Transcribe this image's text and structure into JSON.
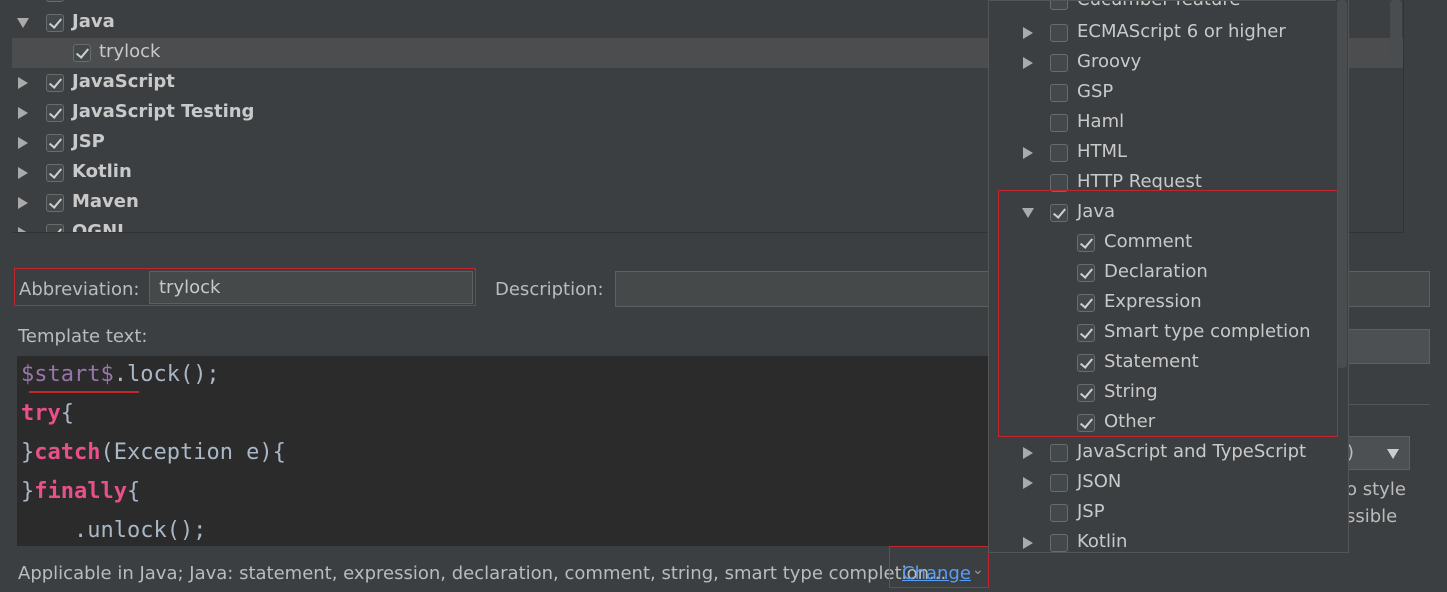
{
  "tree": {
    "rows": [
      {
        "label": "",
        "checked": true,
        "expandable": true,
        "expanded": false
      },
      {
        "label": "Java",
        "checked": true,
        "expandable": true,
        "expanded": true
      },
      {
        "label": "trylock",
        "checked": true,
        "expandable": false,
        "selected": true
      },
      {
        "label": "JavaScript",
        "checked": true,
        "expandable": true
      },
      {
        "label": "JavaScript Testing",
        "checked": true,
        "expandable": true
      },
      {
        "label": "JSP",
        "checked": true,
        "expandable": true
      },
      {
        "label": "Kotlin",
        "checked": true,
        "expandable": true
      },
      {
        "label": "Maven",
        "checked": true,
        "expandable": true
      },
      {
        "label": "OGNL",
        "checked": true,
        "expandable": true
      }
    ]
  },
  "form": {
    "abbreviation_label": "Abbreviation:",
    "abbreviation_value": "trylock",
    "description_label": "Description:",
    "description_value": "",
    "template_text_label": "Template text:"
  },
  "editor": {
    "lines": [
      {
        "parts": [
          {
            "t": "$start$",
            "c": "var"
          },
          {
            "t": ".lock();",
            "c": ""
          }
        ]
      },
      {
        "parts": [
          {
            "t": "try",
            "c": "kw"
          },
          {
            "t": "{",
            "c": ""
          }
        ]
      },
      {
        "parts": [
          {
            "t": "}",
            "c": ""
          },
          {
            "t": "catch",
            "c": "kw"
          },
          {
            "t": "(Exception e){",
            "c": ""
          }
        ]
      },
      {
        "parts": [
          {
            "t": "}",
            "c": ""
          },
          {
            "t": "finally",
            "c": "kw"
          },
          {
            "t": "{",
            "c": ""
          }
        ]
      },
      {
        "parts": [
          {
            "t": "    .unlock();",
            "c": ""
          }
        ]
      }
    ]
  },
  "footer": {
    "applicable_text": "Applicable in Java; Java: statement, expression, declaration, comment, string, smart type completion...",
    "change_link": "Change"
  },
  "right_panel": {
    "text1": "o style",
    "text2": "ssible",
    "combo_text": ")"
  },
  "popup": {
    "items": [
      {
        "label": "Cucumber feature",
        "checked": false,
        "expandable": false,
        "level": 0
      },
      {
        "label": "ECMAScript 6 or higher",
        "checked": false,
        "expandable": true,
        "level": 0
      },
      {
        "label": "Groovy",
        "checked": false,
        "expandable": true,
        "level": 0
      },
      {
        "label": "GSP",
        "checked": false,
        "expandable": false,
        "level": 0
      },
      {
        "label": "Haml",
        "checked": false,
        "expandable": false,
        "level": 0
      },
      {
        "label": "HTML",
        "checked": false,
        "expandable": true,
        "level": 0
      },
      {
        "label": "HTTP Request",
        "checked": false,
        "expandable": false,
        "level": 0
      },
      {
        "label": "Java",
        "checked": true,
        "expandable": true,
        "expanded": true,
        "level": 0
      },
      {
        "label": "Comment",
        "checked": true,
        "expandable": false,
        "level": 1
      },
      {
        "label": "Declaration",
        "checked": true,
        "expandable": false,
        "level": 1
      },
      {
        "label": "Expression",
        "checked": true,
        "expandable": false,
        "level": 1
      },
      {
        "label": "Smart type completion",
        "checked": true,
        "expandable": false,
        "level": 1
      },
      {
        "label": "Statement",
        "checked": true,
        "expandable": false,
        "level": 1
      },
      {
        "label": "String",
        "checked": true,
        "expandable": false,
        "level": 1
      },
      {
        "label": "Other",
        "checked": true,
        "expandable": false,
        "level": 1
      },
      {
        "label": "JavaScript and TypeScript",
        "checked": false,
        "expandable": true,
        "level": 0
      },
      {
        "label": "JSON",
        "checked": false,
        "expandable": true,
        "level": 0
      },
      {
        "label": "JSP",
        "checked": false,
        "expandable": false,
        "level": 0
      },
      {
        "label": "Kotlin",
        "checked": false,
        "expandable": true,
        "level": 0
      }
    ]
  },
  "colors": {
    "background": "#3c3f41",
    "editor_bg": "#2b2b2b",
    "keyword": "#e8508a",
    "variable": "#9876aa",
    "link": "#589df6",
    "highlight_border": "#c0272d"
  }
}
